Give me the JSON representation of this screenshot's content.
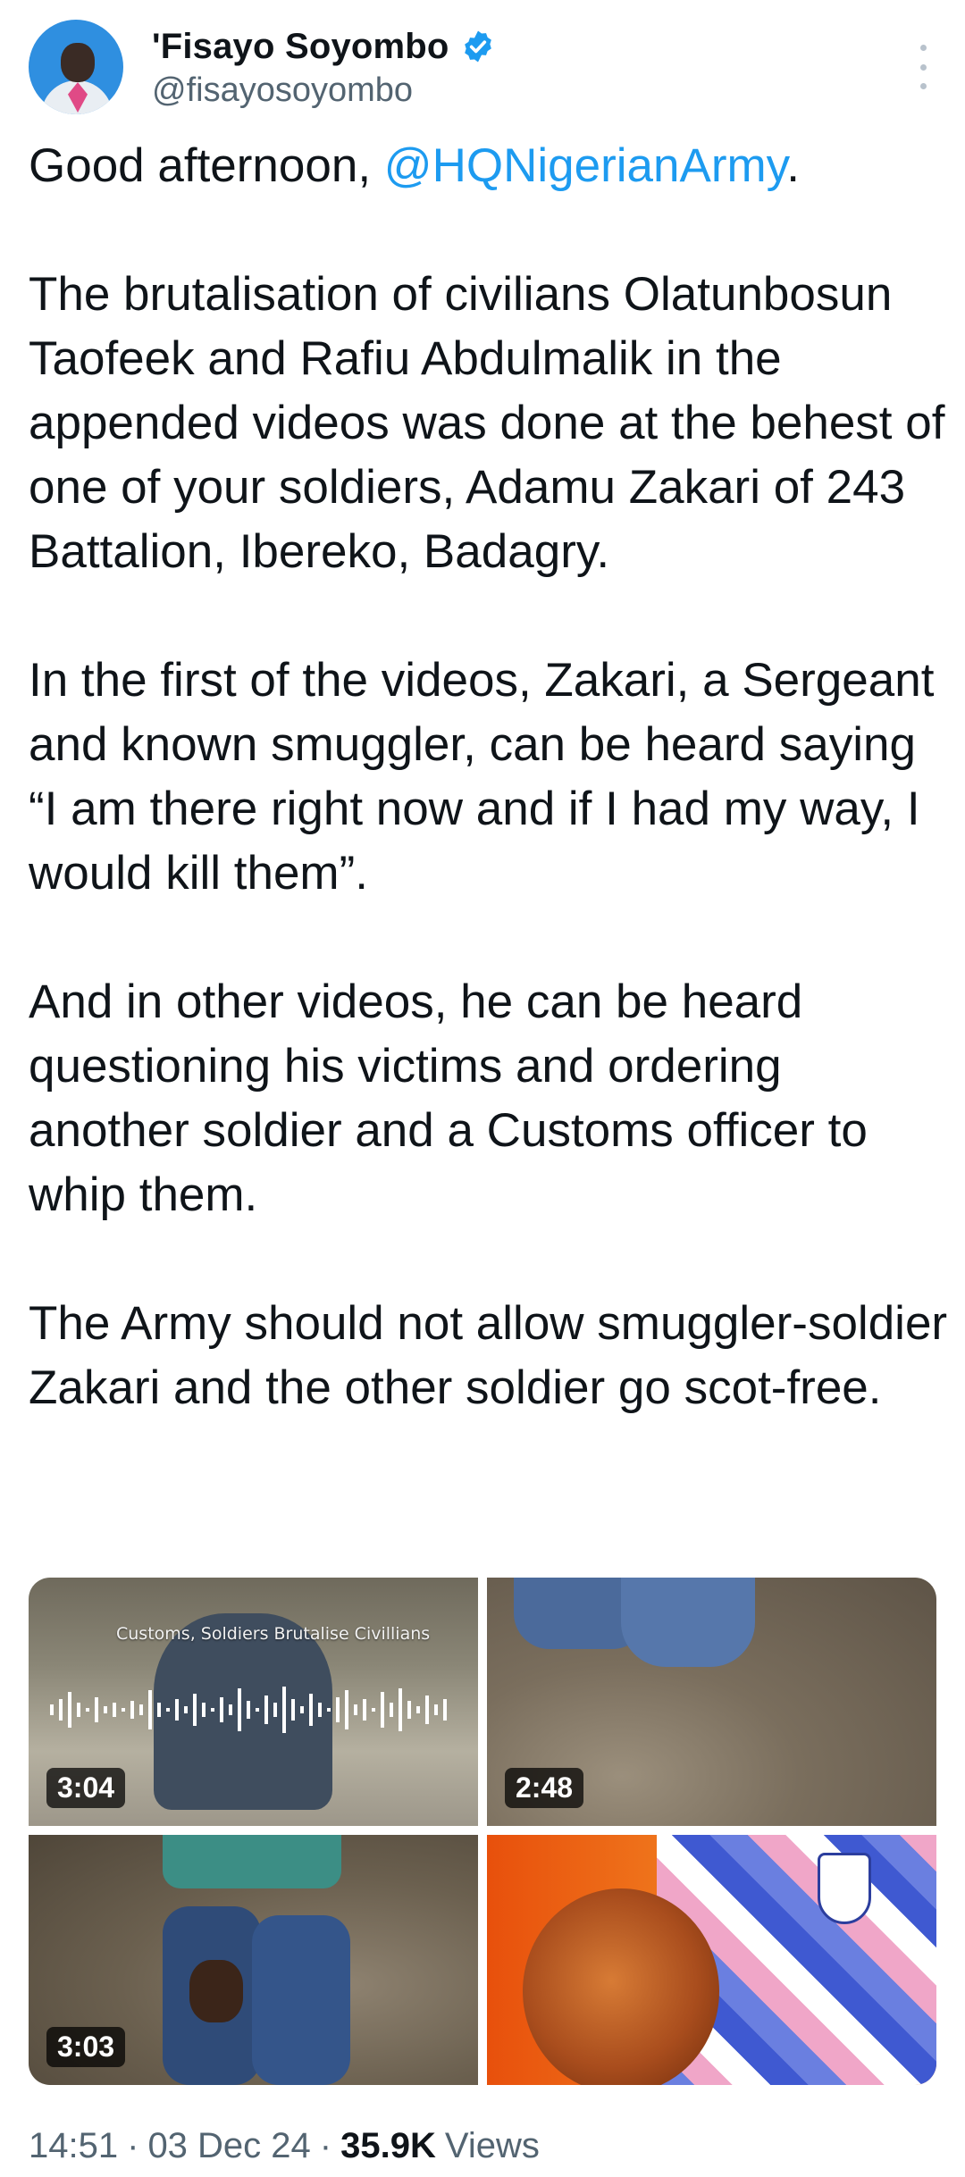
{
  "author": {
    "display_name": "'Fisayo Soyombo",
    "handle": "@fisayosoyombo",
    "verified_icon": "verified-badge",
    "avatar": "avatar"
  },
  "tweet": {
    "greeting": "Good afternoon, ",
    "mention": "@HQNigerianArmy",
    "greeting_end": ".",
    "paragraphs": [
      "The brutalisation of civilians Olatunbosun Taofeek and Rafiu Abdulmalik in the appended videos was done at the behest of one of your soldiers, Adamu Zakari of 243 Battalion, Ibereko, Badagry.",
      "In the first of the videos, Zakari, a Sergeant and known smuggler, can be heard saying “I am there right now and if I had my way, I would kill them”.",
      "And in other videos, he can be heard questioning his victims and ordering another soldier and a Customs officer to whip them.",
      "The Army should not allow smuggler-soldier Zakari and the other soldier go scot-free."
    ]
  },
  "media": {
    "videos": [
      {
        "caption": "Customs, Soldiers Brutalise Civillians",
        "duration": "3:04"
      },
      {
        "duration": "2:48"
      },
      {
        "duration": "3:03"
      },
      {}
    ]
  },
  "meta": {
    "time": "14:51",
    "date": "03 Dec 24",
    "separator": "·",
    "views_count": "35.9K",
    "views_label": "Views"
  },
  "colors": {
    "link": "#1d9bf0",
    "verified": "#1d9bf0",
    "secondary_text": "#536471"
  }
}
